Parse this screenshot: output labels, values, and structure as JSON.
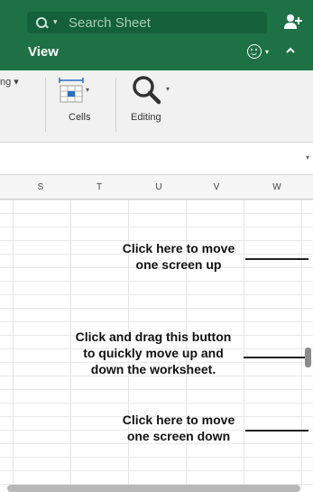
{
  "search": {
    "placeholder": "Search Sheet"
  },
  "ribbon": {
    "active_tab": "View",
    "cut_label": "ng ▾",
    "cells_label": "Cells",
    "editing_label": "Editing"
  },
  "columns": [
    "S",
    "T",
    "U",
    "V",
    "W"
  ],
  "annotations": {
    "screen_up": [
      "Click here to move",
      "one screen up"
    ],
    "drag": [
      "Click and drag this button",
      "to quickly move up and",
      "down the worksheet."
    ],
    "screen_down": [
      "Click here to move",
      "one screen down"
    ]
  },
  "colors": {
    "title_bar": "#1e7145",
    "search_box": "#14603a"
  }
}
